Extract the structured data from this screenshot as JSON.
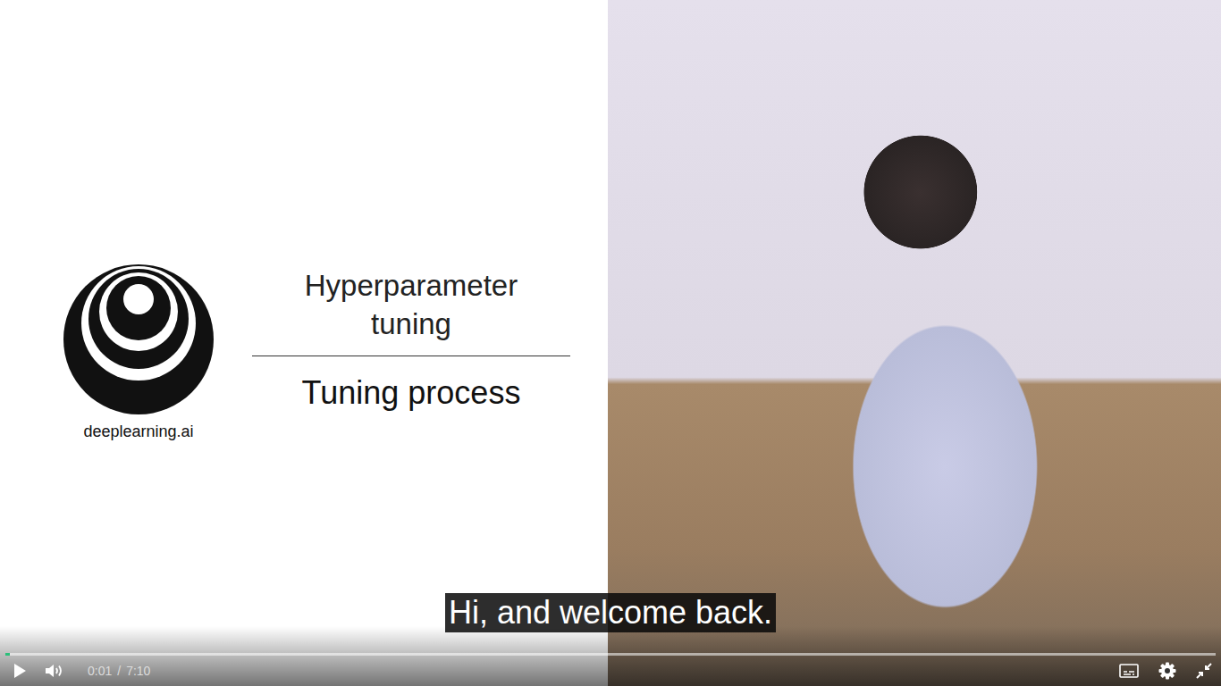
{
  "slide": {
    "logo_text": "deeplearning.ai",
    "title": "Hyperparameter tuning",
    "subtitle": "Tuning process"
  },
  "caption": {
    "text": "Hi, and welcome back.",
    "visible": true
  },
  "player": {
    "playing": false,
    "muted": false,
    "fullscreen": true,
    "captions_on": true,
    "current_time": "0:01",
    "separator": "/",
    "duration": "7:10",
    "progress": {
      "level": 0.004
    }
  }
}
